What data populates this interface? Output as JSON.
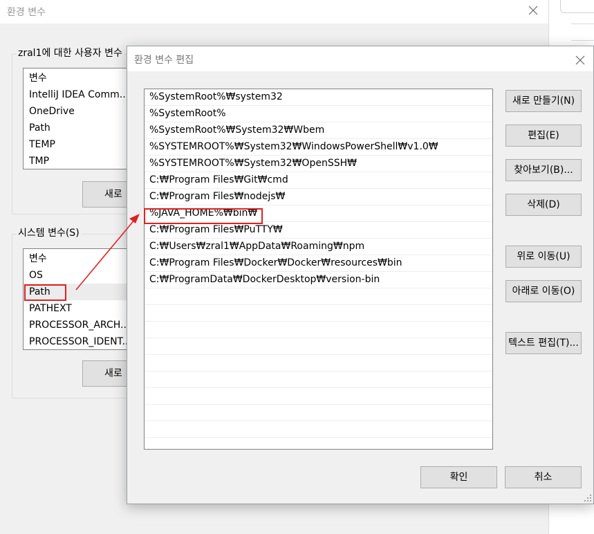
{
  "background_window": {
    "title": "환경 변수",
    "user_group": {
      "label": "zral1에 대한 사용자 변수",
      "header": "변수",
      "items": [
        "IntelliJ IDEA Comm...",
        "OneDrive",
        "Path",
        "TEMP",
        "TMP"
      ],
      "new_button": "새로"
    },
    "system_group": {
      "label": "시스템 변수(S)",
      "header": "변수",
      "items": [
        "OS",
        "Path",
        "PATHEXT",
        "PROCESSOR_ARCH...",
        "PROCESSOR_IDENT..."
      ],
      "selected_item": "Path",
      "new_button": "새로"
    }
  },
  "dialog": {
    "title": "환경 변수 편집",
    "paths": [
      "%SystemRoot%₩system32",
      "%SystemRoot%",
      "%SystemRoot%₩System32₩Wbem",
      "%SYSTEMROOT%₩System32₩WindowsPowerShell₩v1.0₩",
      "%SYSTEMROOT%₩System32₩OpenSSH₩",
      "C:₩Program Files₩Git₩cmd",
      "C:₩Program Files₩nodejs₩",
      "%JAVA_HOME%₩bin₩",
      "C:₩Program Files₩PuTTY₩",
      "C:₩Users₩zral1₩AppData₩Roaming₩npm",
      "C:₩Program Files₩Docker₩Docker₩resources₩bin",
      "C:₩ProgramData₩DockerDesktop₩version-bin"
    ],
    "highlighted_path": "%JAVA_HOME%₩bin₩",
    "buttons": {
      "new": "새로 만들기(N)",
      "edit": "편집(E)",
      "browse": "찾아보기(B)...",
      "delete": "삭제(D)",
      "move_up": "위로 이동(U)",
      "move_down": "아래로 이동(O)",
      "edit_text": "텍스트 편집(T)...",
      "ok": "확인",
      "cancel": "취소"
    }
  },
  "icons": {
    "close": "close-icon",
    "resize": "resize-grip-icon"
  },
  "colors": {
    "annotation": "#e02020",
    "button_bg": "#e1e1e1",
    "window_bg": "#f0f0f0"
  }
}
